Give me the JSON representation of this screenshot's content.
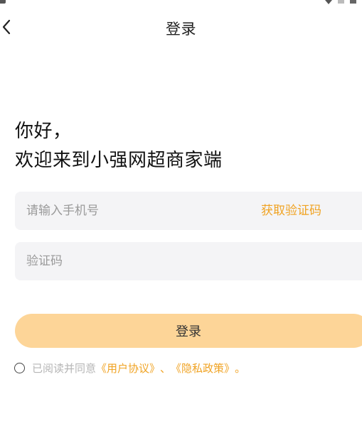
{
  "header": {
    "title": "登录",
    "back_icon": "chevron-left-icon"
  },
  "greeting": {
    "line1": "你好，",
    "line2": "欢迎来到小强网超商家端"
  },
  "form": {
    "phone_placeholder": "请输入手机号",
    "phone_value": "",
    "get_code_label": "获取验证码",
    "code_placeholder": "验证码",
    "code_value": ""
  },
  "login_button_label": "登录",
  "agreement": {
    "prefix": "已阅读并同意",
    "user_agreement": "《用户协议》",
    "separator": "、",
    "privacy_policy": "《隐私政策》",
    "suffix": "。",
    "checked": false
  },
  "colors": {
    "accent": "#f0a323",
    "button_bg": "#fdd598",
    "field_bg": "#f4f4f6",
    "placeholder": "#9a9a9a"
  }
}
